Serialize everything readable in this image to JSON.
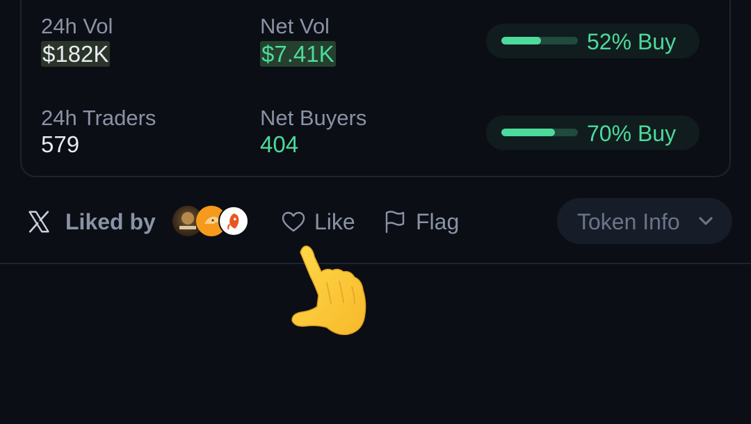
{
  "stats": {
    "vol": {
      "label": "24h Vol",
      "value": "$182K"
    },
    "net_vol": {
      "label": "Net Vol",
      "value": "$7.41K"
    },
    "traders": {
      "label": "24h Traders",
      "value": "579"
    },
    "net_buyers": {
      "label": "Net Buyers",
      "value": "404"
    },
    "vol_buy": {
      "label": "52% Buy",
      "ratio": 0.52
    },
    "traders_buy": {
      "label": "70% Buy",
      "ratio": 0.7
    }
  },
  "social": {
    "liked_by_label": "Liked by",
    "like_label": "Like",
    "flag_label": "Flag",
    "token_info_label": "Token Info"
  },
  "colors": {
    "background": "#0b0e14",
    "accent_green": "#4cdb9b",
    "muted_text": "#8a93a6",
    "card_border": "#1c2433"
  },
  "icons": [
    "x-logo-icon",
    "heart-icon",
    "flag-icon",
    "chevron-down-icon",
    "pointing-hand-emoji"
  ]
}
